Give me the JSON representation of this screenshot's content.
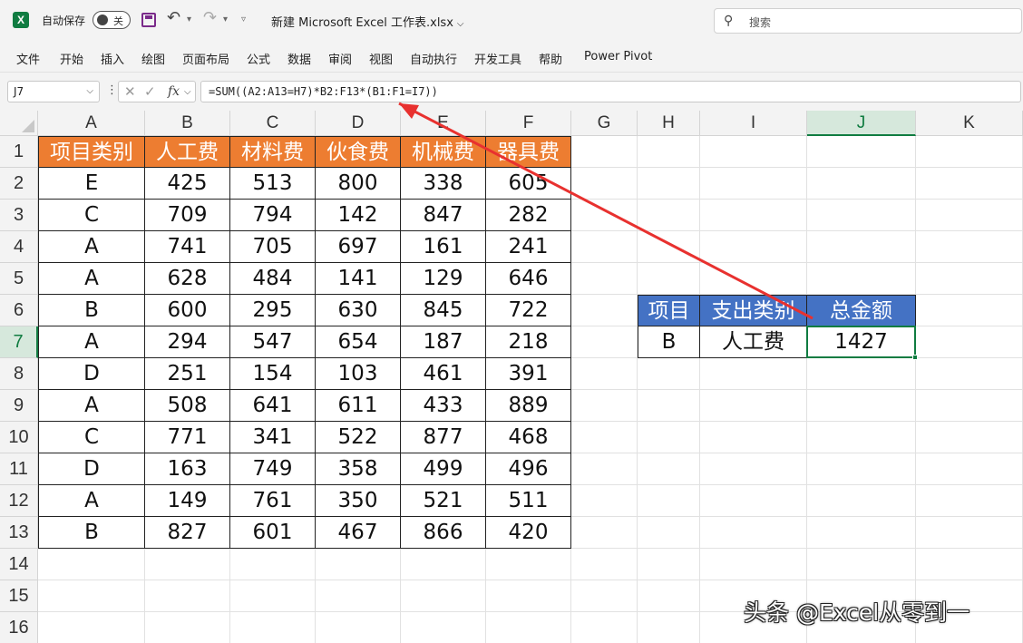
{
  "titlebar": {
    "autosave_label": "自动保存",
    "autosave_state": "关",
    "file_title": "新建 Microsoft Excel 工作表.xlsx",
    "search_placeholder": "搜索"
  },
  "ribbon": {
    "tabs": [
      "文件",
      "开始",
      "插入",
      "绘图",
      "页面布局",
      "公式",
      "数据",
      "审阅",
      "视图",
      "自动执行",
      "开发工具",
      "帮助",
      "Power Pivot"
    ]
  },
  "formula_bar": {
    "name_box": "J7",
    "formula": "=SUM((A2:A13=H7)*B2:F13*(B1:F1=I7))"
  },
  "grid": {
    "columns": [
      "A",
      "B",
      "C",
      "D",
      "E",
      "F",
      "G",
      "H",
      "I",
      "J",
      "K"
    ],
    "rows": [
      "1",
      "2",
      "3",
      "4",
      "5",
      "6",
      "7",
      "8",
      "9",
      "10",
      "11",
      "12",
      "13",
      "14",
      "15",
      "16"
    ],
    "selected_column": "J",
    "selected_row": "7"
  },
  "data_table": {
    "headers": [
      "项目类别",
      "人工费",
      "材料费",
      "伙食费",
      "机械费",
      "器具费"
    ],
    "rows": [
      [
        "E",
        "425",
        "513",
        "800",
        "338",
        "605"
      ],
      [
        "C",
        "709",
        "794",
        "142",
        "847",
        "282"
      ],
      [
        "A",
        "741",
        "705",
        "697",
        "161",
        "241"
      ],
      [
        "A",
        "628",
        "484",
        "141",
        "129",
        "646"
      ],
      [
        "B",
        "600",
        "295",
        "630",
        "845",
        "722"
      ],
      [
        "A",
        "294",
        "547",
        "654",
        "187",
        "218"
      ],
      [
        "D",
        "251",
        "154",
        "103",
        "461",
        "391"
      ],
      [
        "A",
        "508",
        "641",
        "611",
        "433",
        "889"
      ],
      [
        "C",
        "771",
        "341",
        "522",
        "877",
        "468"
      ],
      [
        "D",
        "163",
        "749",
        "358",
        "499",
        "496"
      ],
      [
        "A",
        "149",
        "761",
        "350",
        "521",
        "511"
      ],
      [
        "B",
        "827",
        "601",
        "467",
        "866",
        "420"
      ]
    ]
  },
  "lookup_table": {
    "headers": [
      "项目",
      "支出类别",
      "总金额"
    ],
    "row": [
      "B",
      "人工费",
      "1427"
    ]
  },
  "colors": {
    "data_header": "#ed7d31",
    "lookup_header": "#4472c4",
    "selection": "#107c41",
    "arrow": "#e8312f"
  },
  "watermark": "头条 @Excel从零到一"
}
